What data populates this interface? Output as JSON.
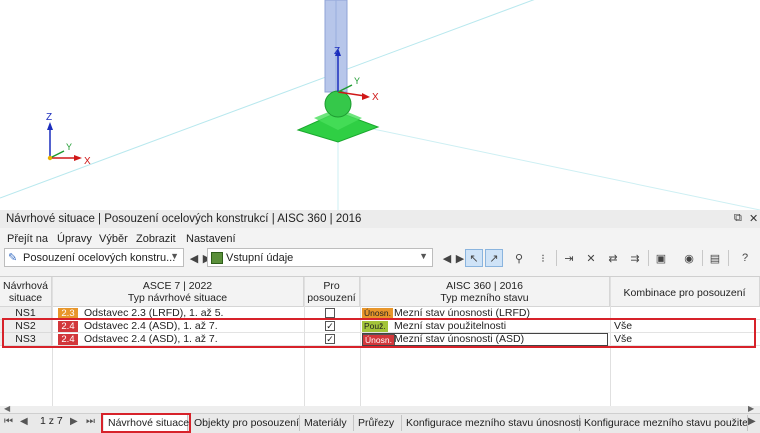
{
  "viewport": {
    "axis_labels": {
      "x": "X",
      "y": "Y",
      "z": "Z"
    }
  },
  "panel": {
    "title": "Návrhové situace | Posouzení ocelových konstrukcí | AISC 360 | 2016",
    "title_controls": [
      "restore-icon",
      "close-icon"
    ],
    "menu": [
      "Přejít na",
      "Úpravy",
      "Výběr",
      "Zobrazit",
      "Nastavení"
    ],
    "toolbar": {
      "module_combo": "Posouzení ocelových konstru...",
      "input_combo": "Vstupní údaje"
    },
    "table": {
      "headers": {
        "c0": "Návrhová\nsituace",
        "c1_top": "ASCE 7 | 2022",
        "c1_bottom": "Typ návrhové situace",
        "c2": "Pro\nposouzení",
        "c3_top": "AISC 360 | 2016",
        "c3_bottom": "Typ mezního stavu",
        "c4": "Kombinace pro posouzení"
      },
      "rows": [
        {
          "id": "NS1",
          "code": "2.3",
          "code_color": "#e8962a",
          "desc": "Odstavec 2.3 (LRFD), 1. až 5.",
          "checked": "",
          "ls_badge": "Únosn.",
          "ls_color": "#e8962a",
          "ls": "Mezní stav únosnosti (LRFD)",
          "combo": ""
        },
        {
          "id": "NS2",
          "code": "2.4",
          "code_color": "#d2373b",
          "desc": "Odstavec 2.4 (ASD), 1. až 7.",
          "checked": "✓",
          "ls_badge": "Použ.",
          "ls_color": "#a3c43a",
          "ls": "Mezní stav použitelnosti",
          "combo": "Vše"
        },
        {
          "id": "NS3",
          "code": "2.4",
          "code_color": "#d2373b",
          "desc": "Odstavec 2.4 (ASD), 1. až 7.",
          "checked": "✓",
          "ls_badge": "Únosn.",
          "ls_color": "#d2373b",
          "ls": "Mezní stav únosnosti (ASD)",
          "combo": "Vše"
        }
      ]
    },
    "pager": "1 z 7",
    "tabs": [
      "Návrhové situace",
      "Objekty pro posouzení",
      "Materiály",
      "Průřezy",
      "Konfigurace mezního stavu únosnosti",
      "Konfigurace mezního stavu použitelr"
    ],
    "active_tab": "Návrhové situace",
    "highlight_color": "#d7222a"
  }
}
